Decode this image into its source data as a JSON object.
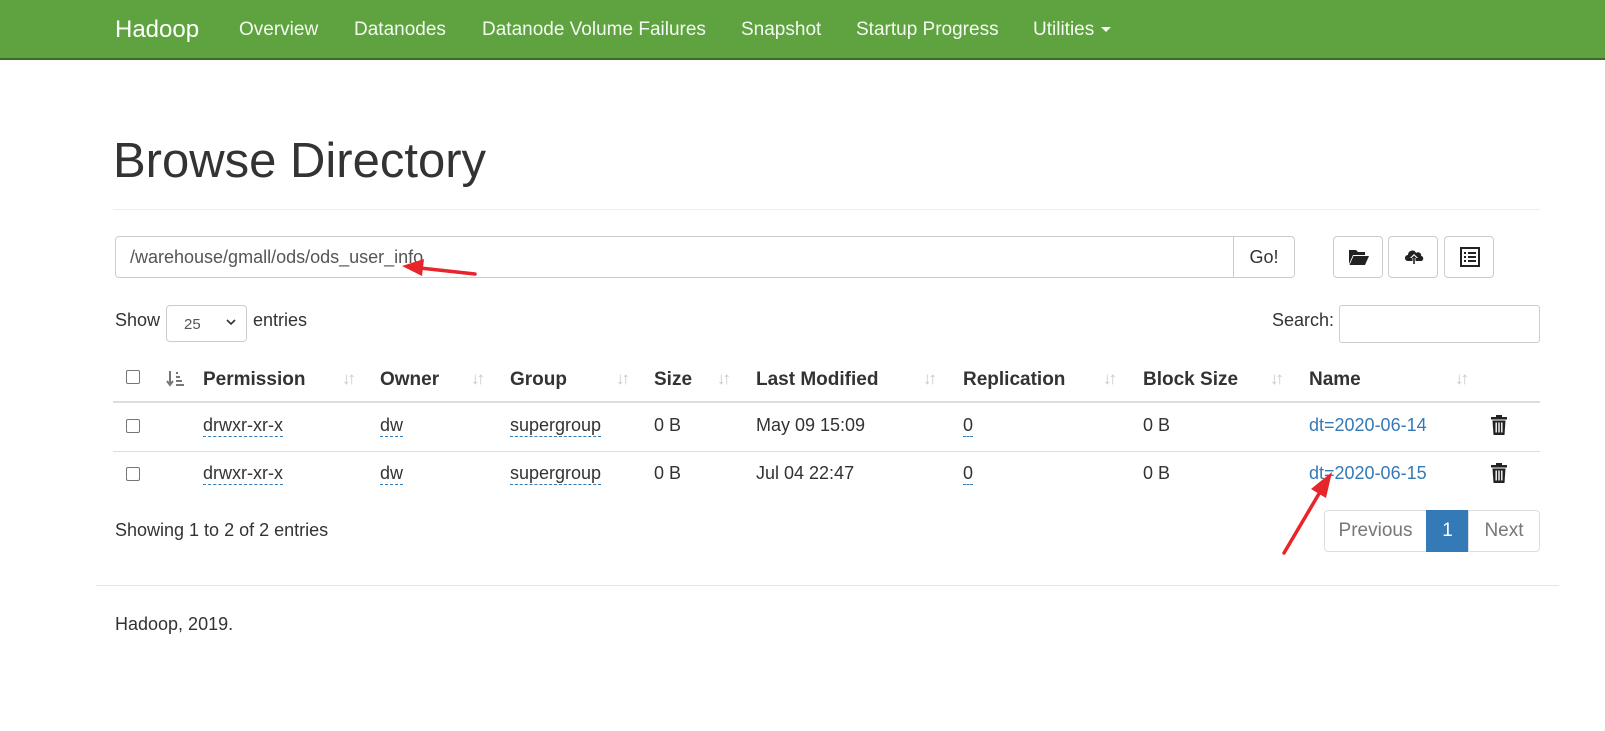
{
  "navbar": {
    "brand": "Hadoop",
    "items": [
      "Overview",
      "Datanodes",
      "Datanode Volume Failures",
      "Snapshot",
      "Startup Progress",
      "Utilities"
    ],
    "background": "#5fa341"
  },
  "page": {
    "title": "Browse Directory"
  },
  "path_bar": {
    "value": "/warehouse/gmall/ods/ods_user_info",
    "go_label": "Go!"
  },
  "toolbar_icons": [
    "folder-open-icon",
    "cloud-upload-icon",
    "list-alt-icon"
  ],
  "length_menu": {
    "show_label": "Show",
    "selected": "25",
    "entries_label": "entries"
  },
  "search": {
    "label": "Search:"
  },
  "table": {
    "columns": [
      "Permission",
      "Owner",
      "Group",
      "Size",
      "Last Modified",
      "Replication",
      "Block Size",
      "Name"
    ],
    "rows": [
      {
        "permission": "drwxr-xr-x",
        "owner": "dw",
        "group": "supergroup",
        "size": "0 B",
        "last_modified": "May 09 15:09",
        "replication": "0",
        "block_size": "0 B",
        "name": "dt=2020-06-14"
      },
      {
        "permission": "drwxr-xr-x",
        "owner": "dw",
        "group": "supergroup",
        "size": "0 B",
        "last_modified": "Jul 04 22:47",
        "replication": "0",
        "block_size": "0 B",
        "name": "dt=2020-06-15"
      }
    ]
  },
  "info": "Showing 1 to 2 of 2 entries",
  "pagination": {
    "previous": "Previous",
    "current": "1",
    "next": "Next"
  },
  "footer": "Hadoop, 2019.",
  "colors": {
    "accent": "#337ab7",
    "annotation": "#e8252b"
  }
}
